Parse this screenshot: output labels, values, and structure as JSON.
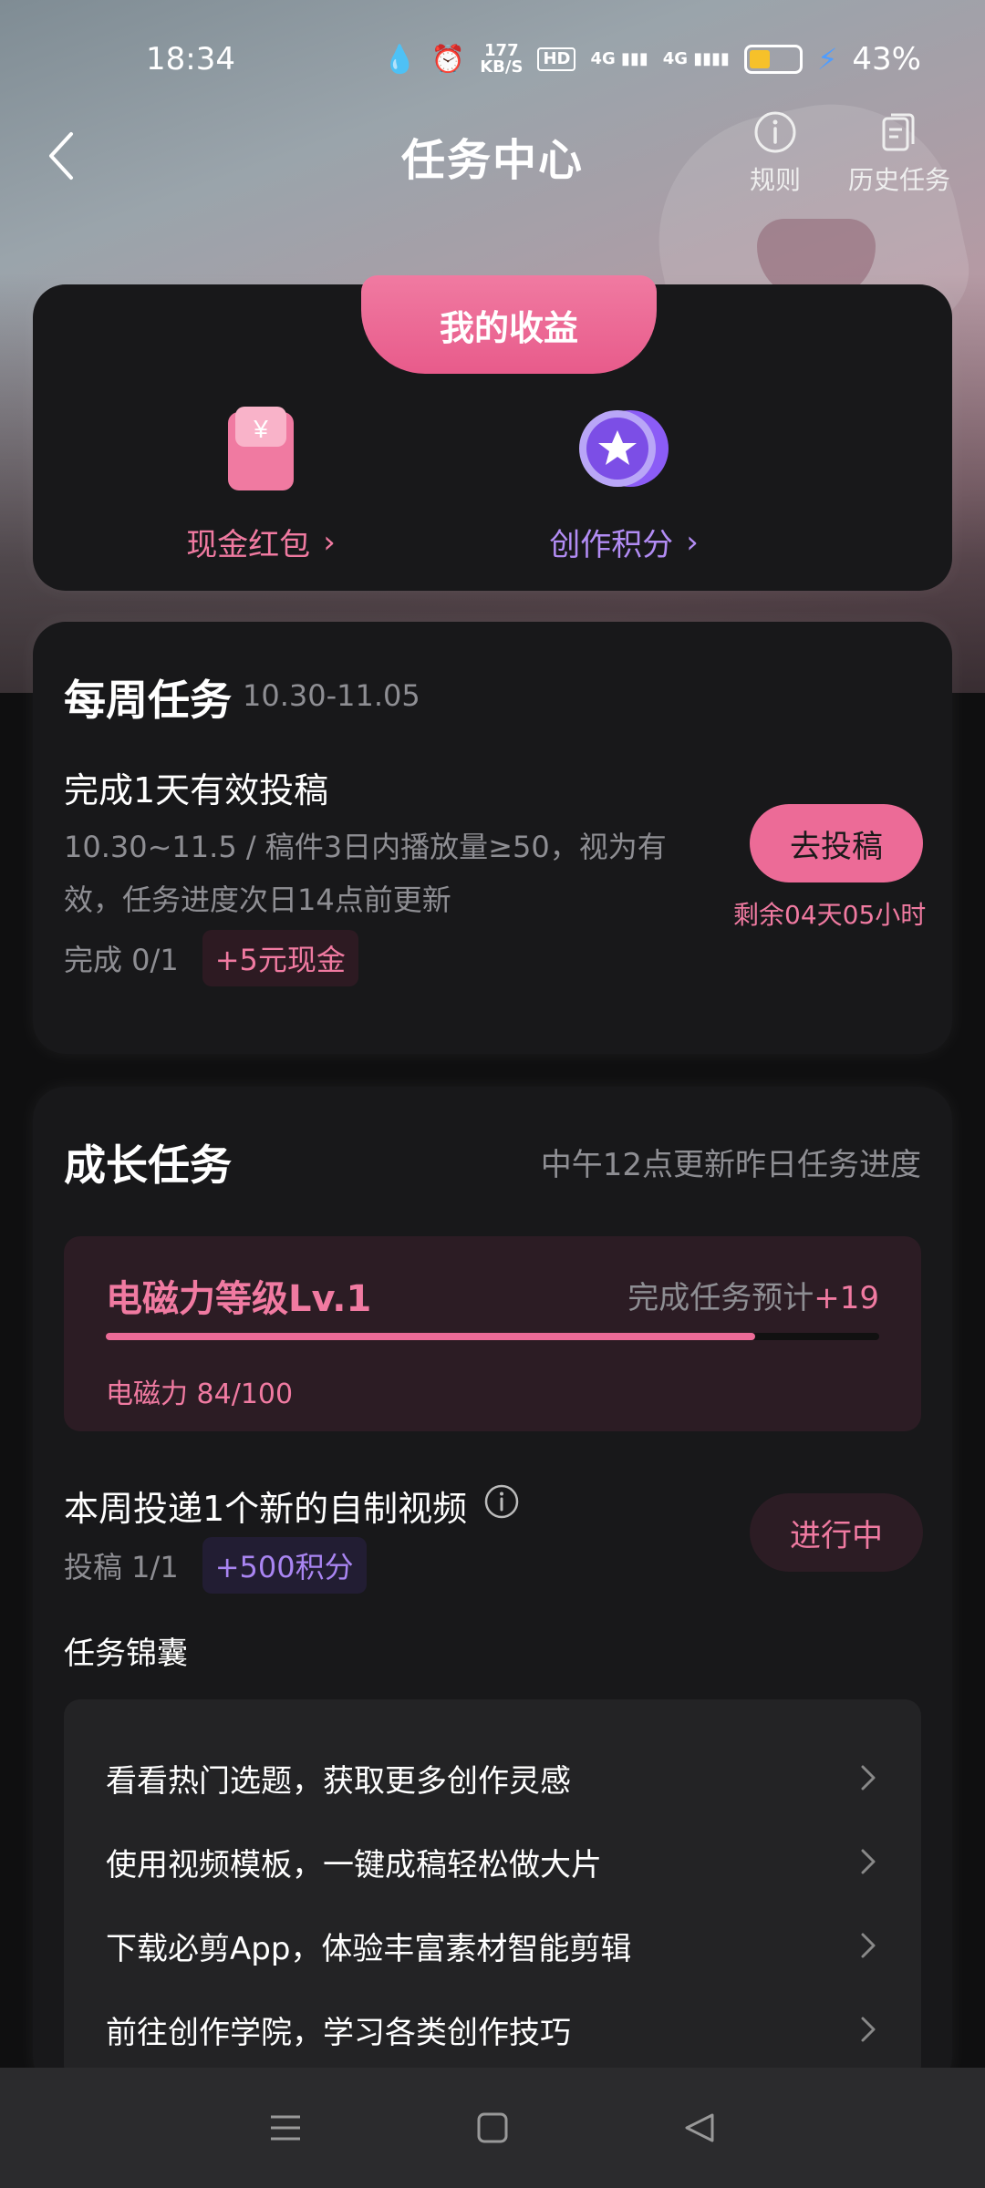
{
  "status_bar": {
    "time": "18:34",
    "net_speed_value": "177",
    "net_speed_unit": "KB/S",
    "hd_label": "HD",
    "signal1_label": "4G",
    "signal2_label": "4G",
    "battery_percent": "43%",
    "battery_level": 0.43,
    "battery_color": "#f6c12a"
  },
  "header": {
    "title": "任务中心",
    "rules_label": "规则",
    "history_label": "历史任务"
  },
  "earnings": {
    "tab_label": "我的收益",
    "cash_label": "现金红包",
    "points_label": "创作积分"
  },
  "weekly": {
    "title": "每周任务",
    "date_range": "10.30-11.05",
    "task_name": "完成1天有效投稿",
    "task_desc": "10.30~11.5 / 稿件3日内播放量≥50，视为有效，任务进度次日14点前更新",
    "progress_text": "完成 0/1",
    "reward": "+5元现金",
    "button_label": "去投稿",
    "remaining": "剩余04天05小时"
  },
  "growth": {
    "title": "成长任务",
    "note": "中午12点更新昨日任务进度",
    "level_name": "电磁力等级Lv.1",
    "level_est_label": "完成任务预计",
    "level_est_value": "+19",
    "level_value_text": "电磁力 84/100",
    "level_progress": 0.84,
    "task_name": "本周投递1个新的自制视频",
    "progress_text": "投稿 1/1",
    "reward": "+500积分",
    "status_label": "进行中",
    "tips_title": "任务锦囊",
    "tips": [
      {
        "label": "看看热门选题，获取更多创作灵感"
      },
      {
        "label": "使用视频模板，一键成稿轻松做大片"
      },
      {
        "label": "下载必剪App，体验丰富素材智能剪辑"
      },
      {
        "label": "前往创作学院，学习各类创作技巧"
      }
    ]
  },
  "colors": {
    "accent_pink": "#ec6b97",
    "accent_purple": "#a985f2",
    "card_bg": "#18181a"
  },
  "icons": {
    "back": "chevron-left-icon",
    "rules": "info-circle-icon",
    "history": "history-doc-icon",
    "cash": "red-envelope-icon",
    "points": "star-coin-icon",
    "info": "info-icon",
    "tip_arrow": "chevron-right-icon",
    "nav_menu": "menu-icon",
    "nav_home": "home-square-icon",
    "nav_back": "back-triangle-icon"
  }
}
